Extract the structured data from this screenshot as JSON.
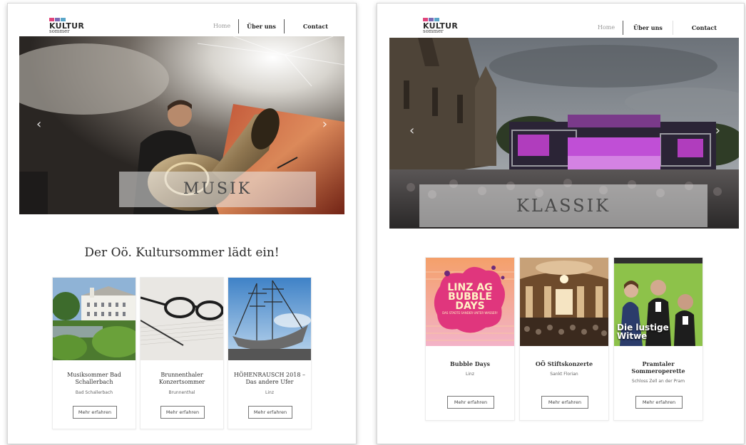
{
  "colors": {
    "text": "#333333",
    "nav_dim": "#9a9a9a",
    "border": "#ececec"
  },
  "left_page": {
    "logo": {
      "word": "KULTUR",
      "sub": "sommer"
    },
    "nav": [
      "Home",
      "Über uns",
      "Contact"
    ],
    "hero": {
      "label": "MUSIK",
      "arrow_prev_icon": "chevron-left-icon",
      "arrow_next_icon": "chevron-right-icon"
    },
    "intro_title": "Der Oö. Kultursommer lädt ein!",
    "cards": [
      {
        "title": "Musiksommer Bad Schallerbach",
        "location": "Bad Schallerbach",
        "button": "Mehr erfahren"
      },
      {
        "title": "Brunnenthaler Konzertsommer",
        "location": "Brunnenthal",
        "button": "Mehr erfahren"
      },
      {
        "title": "HÖHENRAUSCH 2018 – Das andere Ufer",
        "location": "Linz",
        "button": "Mehr erfahren"
      }
    ]
  },
  "right_page": {
    "logo": {
      "word": "KULTUR",
      "sub": "sommer"
    },
    "nav": [
      "Home",
      "Über uns",
      "Contact"
    ],
    "hero": {
      "label": "KLASSIK",
      "arrow_prev_icon": "chevron-left-icon",
      "arrow_next_icon": "chevron-right-icon"
    },
    "cards": [
      {
        "title": "Bubble Days",
        "location": "Linz",
        "button": "Mehr erfahren",
        "poster": {
          "line1": "LINZ AG",
          "line2": "BUBBLE",
          "line3": "DAYS",
          "small": "DAS STADTE SANDER UNTER WASSER!"
        }
      },
      {
        "title": "OÖ Stiftskonzerte",
        "location": "Sankt Florian",
        "button": "Mehr erfahren"
      },
      {
        "title": "Pramtaler Sommeroperette",
        "location": "Schloss Zell an der Pram",
        "button": "Mehr erfahren",
        "poster": {
          "line1": "Die lustige",
          "line2": "Witwe"
        }
      }
    ]
  }
}
